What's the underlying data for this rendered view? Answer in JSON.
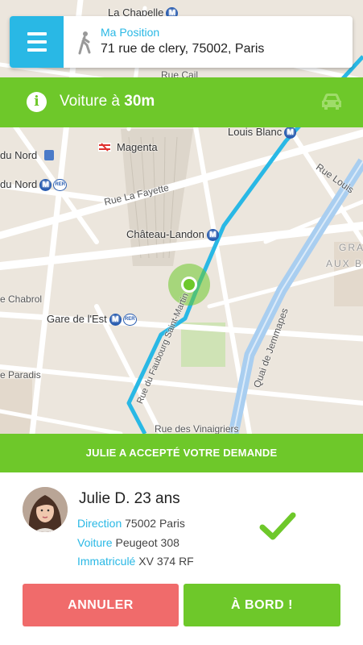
{
  "header": {
    "position_title": "Ma Position",
    "position_address": "71 rue de clery, 75002, Paris"
  },
  "info_bar": {
    "text_prefix": "Voiture à ",
    "distance": "30m"
  },
  "map": {
    "labels": {
      "la_chapelle": "La Chapelle",
      "rue_cail": "Rue Cail",
      "louis_blanc": "Louis Blanc",
      "du_nord_1": "du Nord",
      "magenta": "Magenta",
      "rue_louis": "Rue Louis",
      "du_nord_2": "du Nord",
      "rue_la_fayette": "Rue La Fayette",
      "chateau_landon": "Château-Landon",
      "gra": "GRA",
      "aux_be": "AUX BE",
      "chabrol": "e Chabrol",
      "gare_est": "Gare de l'Est",
      "rue_fbg": "Rue du Faubourg Saint-Martin",
      "quai_jemmapes": "Quai de Jemmapes",
      "paradis": "e Paradis",
      "vinaigriers": "Rue des Vinaigriers"
    },
    "metro_glyph": "M",
    "rer_glyph": "RER",
    "route_color": "#29b8e5",
    "position_color": "#6ec82a"
  },
  "accept_banner": "JULIE A ACCEPTÉ VOTRE DEMANDE",
  "driver": {
    "name": "Julie D.",
    "age": "23 ans",
    "direction_label": "Direction",
    "direction_value": "75002 Paris",
    "car_label": "Voiture",
    "car_value": "Peugeot 308",
    "plate_label": "Immatriculé",
    "plate_value": "XV 374 RF"
  },
  "actions": {
    "cancel_label": "ANNULER",
    "board_label": "À BORD !"
  },
  "colors": {
    "accent_blue": "#29b8e5",
    "accent_green": "#6ec82a",
    "cancel_red": "#f06b6b"
  },
  "icons": {
    "menu": "menu-icon",
    "walk": "walking-person-icon",
    "info": "info-icon",
    "car": "car-icon",
    "check": "checkmark-icon"
  }
}
